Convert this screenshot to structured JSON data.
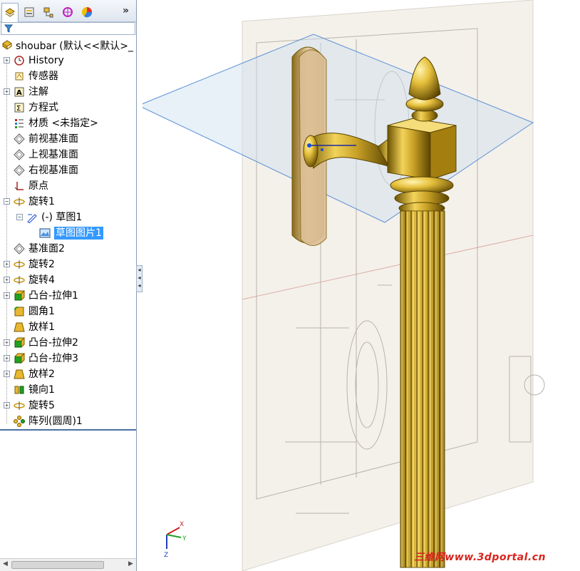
{
  "feature_tree": {
    "toolbar_tabs": [
      {
        "icon": "feature-manager-icon",
        "active": true
      },
      {
        "icon": "property-manager-icon",
        "active": false
      },
      {
        "icon": "configuration-manager-icon",
        "active": false
      },
      {
        "icon": "dimxpert-icon",
        "active": false
      },
      {
        "icon": "display-manager-icon",
        "active": false
      }
    ],
    "more_label": "»",
    "root_label": "shoubar  (默认<<默认>_",
    "items": [
      {
        "label": "History",
        "icon": "history-icon",
        "indent": 0,
        "expand": "+"
      },
      {
        "label": "传感器",
        "icon": "sensor-icon",
        "indent": 0,
        "expand": ""
      },
      {
        "label": "注解",
        "icon": "annotation-icon",
        "indent": 0,
        "expand": "+"
      },
      {
        "label": "方程式",
        "icon": "equation-icon",
        "indent": 0,
        "expand": ""
      },
      {
        "label": "材质 <未指定>",
        "icon": "material-icon",
        "indent": 0,
        "expand": ""
      },
      {
        "label": "前视基准面",
        "icon": "plane-icon",
        "indent": 0,
        "expand": ""
      },
      {
        "label": "上视基准面",
        "icon": "plane-icon",
        "indent": 0,
        "expand": ""
      },
      {
        "label": "右视基准面",
        "icon": "plane-icon",
        "indent": 0,
        "expand": ""
      },
      {
        "label": "原点",
        "icon": "origin-icon",
        "indent": 0,
        "expand": ""
      },
      {
        "label": "旋转1",
        "icon": "revolve-icon",
        "indent": 0,
        "expand": "−"
      },
      {
        "label": "(-) 草图1",
        "icon": "sketch-icon",
        "indent": 1,
        "expand": "−"
      },
      {
        "label": "草图图片1",
        "icon": "sketch-picture-icon",
        "indent": 2,
        "expand": "",
        "selected": true
      },
      {
        "label": "基准面2",
        "icon": "plane-icon",
        "indent": 0,
        "expand": ""
      },
      {
        "label": "旋转2",
        "icon": "revolve-icon",
        "indent": 0,
        "expand": "+"
      },
      {
        "label": "旋转4",
        "icon": "revolve-icon",
        "indent": 0,
        "expand": "+"
      },
      {
        "label": "凸台-拉伸1",
        "icon": "extrude-icon",
        "indent": 0,
        "expand": "+"
      },
      {
        "label": "圆角1",
        "icon": "fillet-icon",
        "indent": 0,
        "expand": ""
      },
      {
        "label": "放样1",
        "icon": "loft-icon",
        "indent": 0,
        "expand": ""
      },
      {
        "label": "凸台-拉伸2",
        "icon": "extrude-icon",
        "indent": 0,
        "expand": "+"
      },
      {
        "label": "凸台-拉伸3",
        "icon": "extrude-icon",
        "indent": 0,
        "expand": "+"
      },
      {
        "label": "放样2",
        "icon": "loft-icon",
        "indent": 0,
        "expand": "+"
      },
      {
        "label": "镜向1",
        "icon": "mirror-icon",
        "indent": 0,
        "expand": ""
      },
      {
        "label": "旋转5",
        "icon": "revolve-icon",
        "indent": 0,
        "expand": "+"
      },
      {
        "label": "阵列(圆周)1",
        "icon": "circular-pattern-icon",
        "indent": 0,
        "expand": ""
      }
    ]
  },
  "viewport": {
    "triad_labels": {
      "x": "X",
      "y": "Y",
      "z": "Z"
    },
    "watermark": "三维网www.3dportal.cn",
    "colors": {
      "gold": "#c9a227",
      "plane": "#5a8fd6",
      "selection": "#3399ff"
    }
  }
}
